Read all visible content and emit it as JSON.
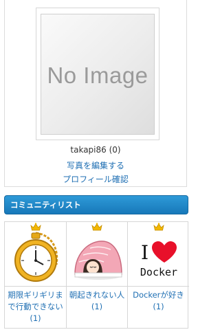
{
  "profile": {
    "photo_placeholder": "No Image",
    "username": "takapi86 (0)",
    "edit_photo_link": "写真を編集する",
    "profile_link": "プロフィール確認"
  },
  "community": {
    "header": "コミュニティリスト",
    "items": [
      {
        "label": "期限ギリギリまで行動できない (1)",
        "icon": "pocket-watch"
      },
      {
        "label": "朝起きれない人 (1)",
        "icon": "sleeping-in-futon"
      },
      {
        "label": "Dockerが好き (1)",
        "icon": "i-love-docker",
        "logo_text_i": "I",
        "logo_text_docker": "Docker"
      }
    ]
  },
  "colors": {
    "link": "#1f6fb3",
    "header_bg": "#1778b9",
    "crown": "#f2b701",
    "heart": "#e8102a"
  }
}
